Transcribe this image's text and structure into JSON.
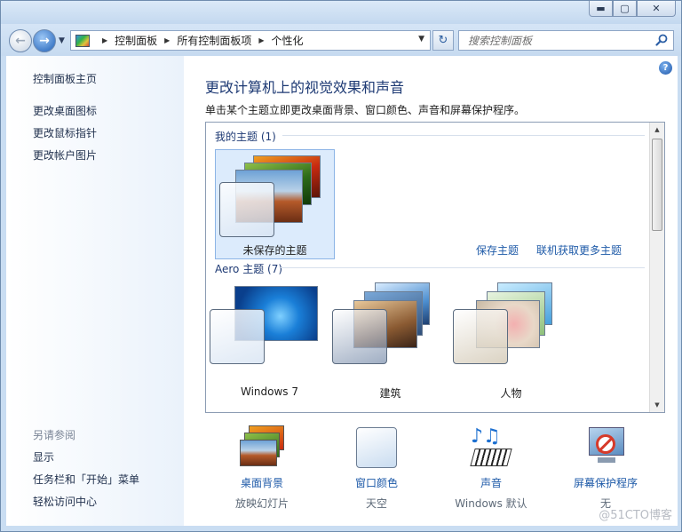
{
  "window": {
    "caption": {
      "minimize": "▬",
      "maximize": "▢",
      "close": "✕"
    }
  },
  "nav": {
    "breadcrumbs": [
      "控制面板",
      "所有控制面板项",
      "个性化"
    ],
    "search_placeholder": "搜索控制面板",
    "refresh_glyph": "↻",
    "back_glyph": "←",
    "forward_glyph": "→"
  },
  "sidebar": {
    "home": "控制面板主页",
    "items": [
      "更改桌面图标",
      "更改鼠标指针",
      "更改帐户图片"
    ],
    "see_also_title": "另请参阅",
    "see_also": [
      "显示",
      "任务栏和「开始」菜单",
      "轻松访问中心"
    ]
  },
  "main": {
    "help_glyph": "?",
    "heading": "更改计算机上的视觉效果和声音",
    "subtitle": "单击某个主题立即更改桌面背景、窗口颜色、声音和屏幕保护程序。",
    "my_themes": {
      "title": "我的主题 (1)",
      "items": [
        "未保存的主题"
      ]
    },
    "save_theme": "保存主题",
    "get_more": "联机获取更多主题",
    "aero_themes": {
      "title": "Aero 主题 (7)",
      "items": [
        "Windows 7",
        "建筑",
        "人物"
      ]
    }
  },
  "bottom": [
    {
      "label": "桌面背景",
      "sub": "放映幻灯片",
      "icon": "desktop-background-icon"
    },
    {
      "label": "窗口颜色",
      "sub": "天空",
      "icon": "window-color-icon"
    },
    {
      "label": "声音",
      "sub": "Windows 默认",
      "icon": "sound-icon"
    },
    {
      "label": "屏幕保护程序",
      "sub": "无",
      "icon": "screensaver-icon"
    }
  ],
  "watermark": "@51CTO博客"
}
